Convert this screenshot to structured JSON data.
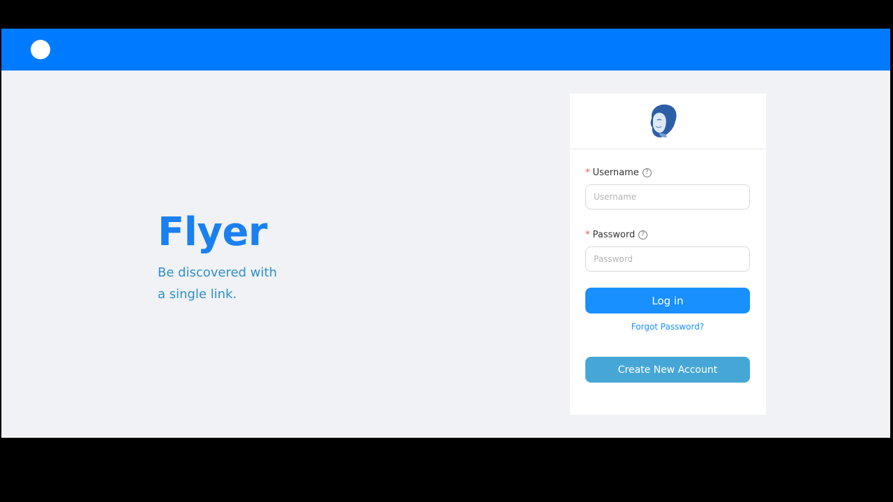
{
  "header": {
    "logo_icon": "circle-logo-icon"
  },
  "hero": {
    "brand": "Flyer",
    "tagline_line1": "Be discovered with",
    "tagline_line2": "a single link."
  },
  "login": {
    "avatar_icon": "user-avatar-icon",
    "username": {
      "label": "Username",
      "placeholder": "Username",
      "value": "",
      "required_mark": "*",
      "help_icon": "question-circle-icon"
    },
    "password": {
      "label": "Password",
      "placeholder": "Password",
      "value": "",
      "required_mark": "*",
      "help_icon": "question-circle-icon"
    },
    "login_button": "Log in",
    "forgot_link": "Forgot Password?",
    "create_button": "Create New Account"
  },
  "colors": {
    "header": "#007bff",
    "background": "#f0f2f5",
    "brand": "#1a80f0",
    "tagline": "#2f8fc7",
    "primary_button": "#1890ff",
    "secondary_button": "#46a7d6",
    "required": "#ff4d4f"
  }
}
